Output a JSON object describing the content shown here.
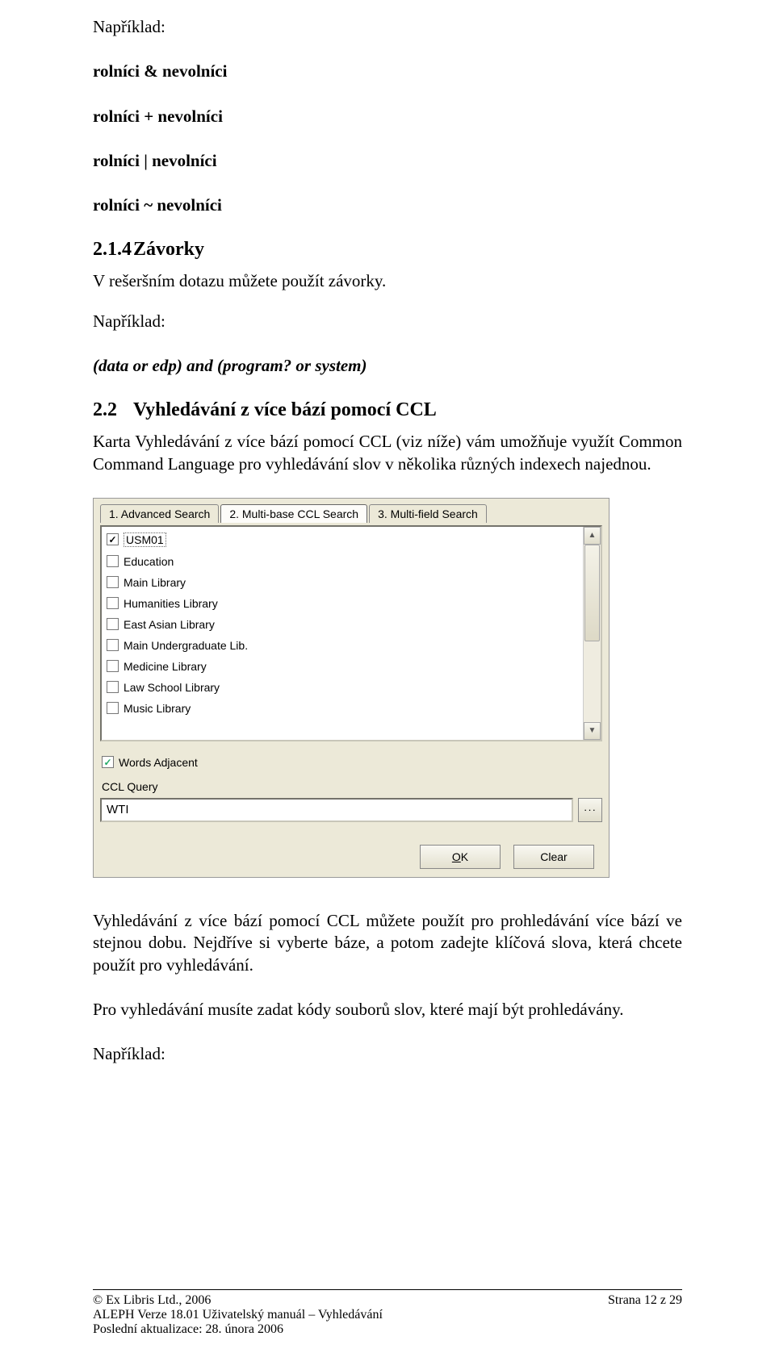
{
  "text": {
    "example1": "Například:",
    "l1": "rolníci & nevolníci",
    "l2": "rolníci + nevolníci",
    "l3": "rolníci | nevolníci",
    "l4": "rolníci ~ nevolníci",
    "h_num": "2.1.4",
    "h_title": "Závorky",
    "p1": "V rešeršním dotazu můžete použít závorky.",
    "example2": "Například:",
    "l5": "(data or edp) and (program? or system)",
    "h2_num": "2.2",
    "h2_title": "Vyhledávání z více bází pomocí CCL",
    "p2": "Karta Vyhledávání z více bází pomocí CCL (viz níže) vám umožňuje využít Common Command Language pro vyhledávání slov v několika různých indexech najednou.",
    "p3": "Vyhledávání z více bází pomocí CCL můžete použít pro prohledávání více bází ve stejnou dobu. Nejdříve si vyberte báze, a potom zadejte klíčová slova, která chcete použít pro vyhledávání.",
    "p4": "Pro vyhledávání musíte zadat kódy souborů slov, které mají být prohledávány.",
    "example3": "Například:"
  },
  "dialog": {
    "tabs": [
      {
        "label": "1. Advanced Search",
        "active": false
      },
      {
        "label": "2. Multi-base CCL Search",
        "active": true
      },
      {
        "label": "3. Multi-field Search",
        "active": false
      }
    ],
    "items": [
      {
        "label": "USM01",
        "checked": true,
        "selected": true
      },
      {
        "label": "Education",
        "checked": false,
        "selected": false
      },
      {
        "label": "Main Library",
        "checked": false,
        "selected": false
      },
      {
        "label": "Humanities Library",
        "checked": false,
        "selected": false
      },
      {
        "label": "East Asian Library",
        "checked": false,
        "selected": false
      },
      {
        "label": "Main Undergraduate Lib.",
        "checked": false,
        "selected": false
      },
      {
        "label": "Medicine Library",
        "checked": false,
        "selected": false
      },
      {
        "label": "Law School Library",
        "checked": false,
        "selected": false
      },
      {
        "label": "Music Library",
        "checked": false,
        "selected": false
      }
    ],
    "words_adjacent": "Words Adjacent",
    "words_adjacent_checked": true,
    "ccl_label": "CCL Query",
    "ccl_value": "WTI",
    "ellipsis": "···",
    "ok_u": "O",
    "ok_rest": "K",
    "clear": "Clear"
  },
  "footer": {
    "left1": "© Ex Libris Ltd., 2006",
    "right1": "Strana 12 z 29",
    "left2": "ALEPH Verze 18.01 Uživatelský manuál – Vyhledávání",
    "left3": "Poslední aktualizace: 28. února 2006"
  }
}
